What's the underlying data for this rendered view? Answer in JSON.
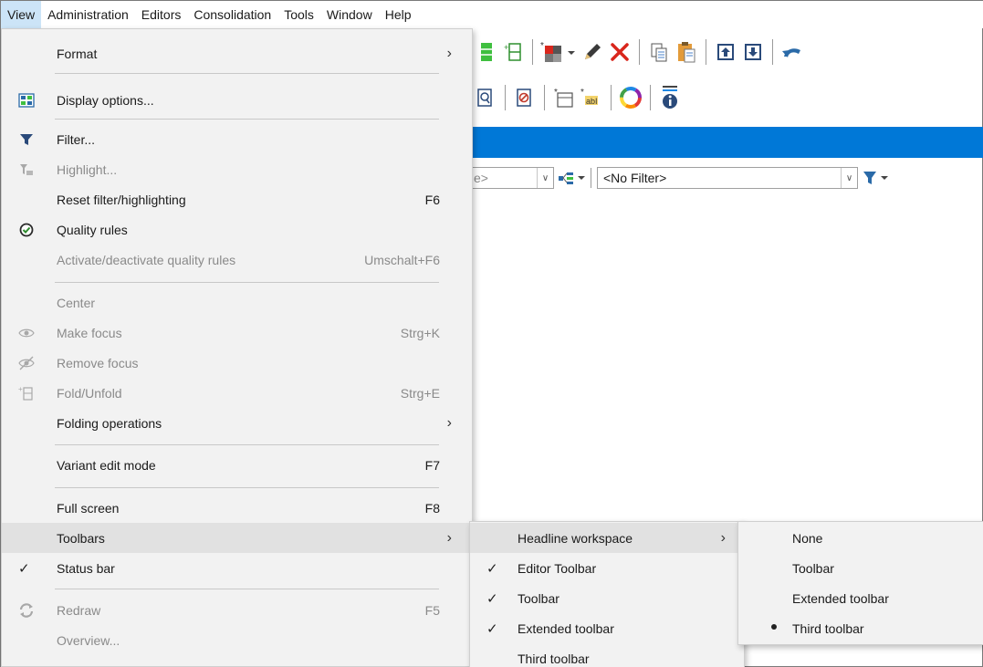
{
  "menubar": {
    "items": [
      "View",
      "Administration",
      "Editors",
      "Consolidation",
      "Tools",
      "Window",
      "Help"
    ]
  },
  "filter_bar": {
    "partial_left_combo": "e>",
    "filter_combo_value": "<No Filter>"
  },
  "view_menu": {
    "items": [
      {
        "label": "Format",
        "submenu": true
      },
      {
        "label": "Display options...",
        "icon": "display-options-icon"
      },
      {
        "label": "Filter...",
        "icon": "filter-icon"
      },
      {
        "label": "Highlight...",
        "icon": "highlight-icon",
        "disabled": true
      },
      {
        "label": "Reset filter/highlighting",
        "shortcut": "F6"
      },
      {
        "label": "Quality rules",
        "icon": "quality-rules-icon"
      },
      {
        "label": "Activate/deactivate quality rules",
        "shortcut": "Umschalt+F6",
        "disabled": true
      },
      {
        "label": "Center",
        "disabled": true
      },
      {
        "label": "Make focus",
        "shortcut": "Strg+K",
        "icon": "eye-icon",
        "disabled": true
      },
      {
        "label": "Remove focus",
        "icon": "eye-slash-icon",
        "disabled": true
      },
      {
        "label": "Fold/Unfold",
        "shortcut": "Strg+E",
        "icon": "fold-icon",
        "disabled": true
      },
      {
        "label": "Folding operations",
        "submenu": true
      },
      {
        "label": "Variant edit mode",
        "shortcut": "F7"
      },
      {
        "label": "Full screen",
        "shortcut": "F8"
      },
      {
        "label": "Toolbars",
        "submenu": true,
        "highlighted": true
      },
      {
        "label": "Status bar",
        "checked": true
      },
      {
        "label": "Redraw",
        "shortcut": "F5",
        "icon": "redraw-icon",
        "disabled": true
      },
      {
        "label": "Overview...",
        "disabled": true
      }
    ]
  },
  "toolbars_submenu": {
    "items": [
      {
        "label": "Headline workspace",
        "submenu": true,
        "highlighted": true
      },
      {
        "label": "Editor Toolbar",
        "checked": true
      },
      {
        "label": "Toolbar",
        "checked": true
      },
      {
        "label": "Extended toolbar",
        "checked": true
      },
      {
        "label": "Third toolbar"
      }
    ]
  },
  "headline_submenu": {
    "items": [
      {
        "label": "None"
      },
      {
        "label": "Toolbar"
      },
      {
        "label": "Extended toolbar"
      },
      {
        "label": "Third toolbar",
        "selected": true
      }
    ]
  },
  "colors": {
    "accent_blue": "#0078d7",
    "menu_bg": "#f2f2f2",
    "hover_bg": "#e1e1e1",
    "disabled_text": "#8a8a8a",
    "delete_red": "#d9261c",
    "quality_green": "#2e8b2e"
  }
}
